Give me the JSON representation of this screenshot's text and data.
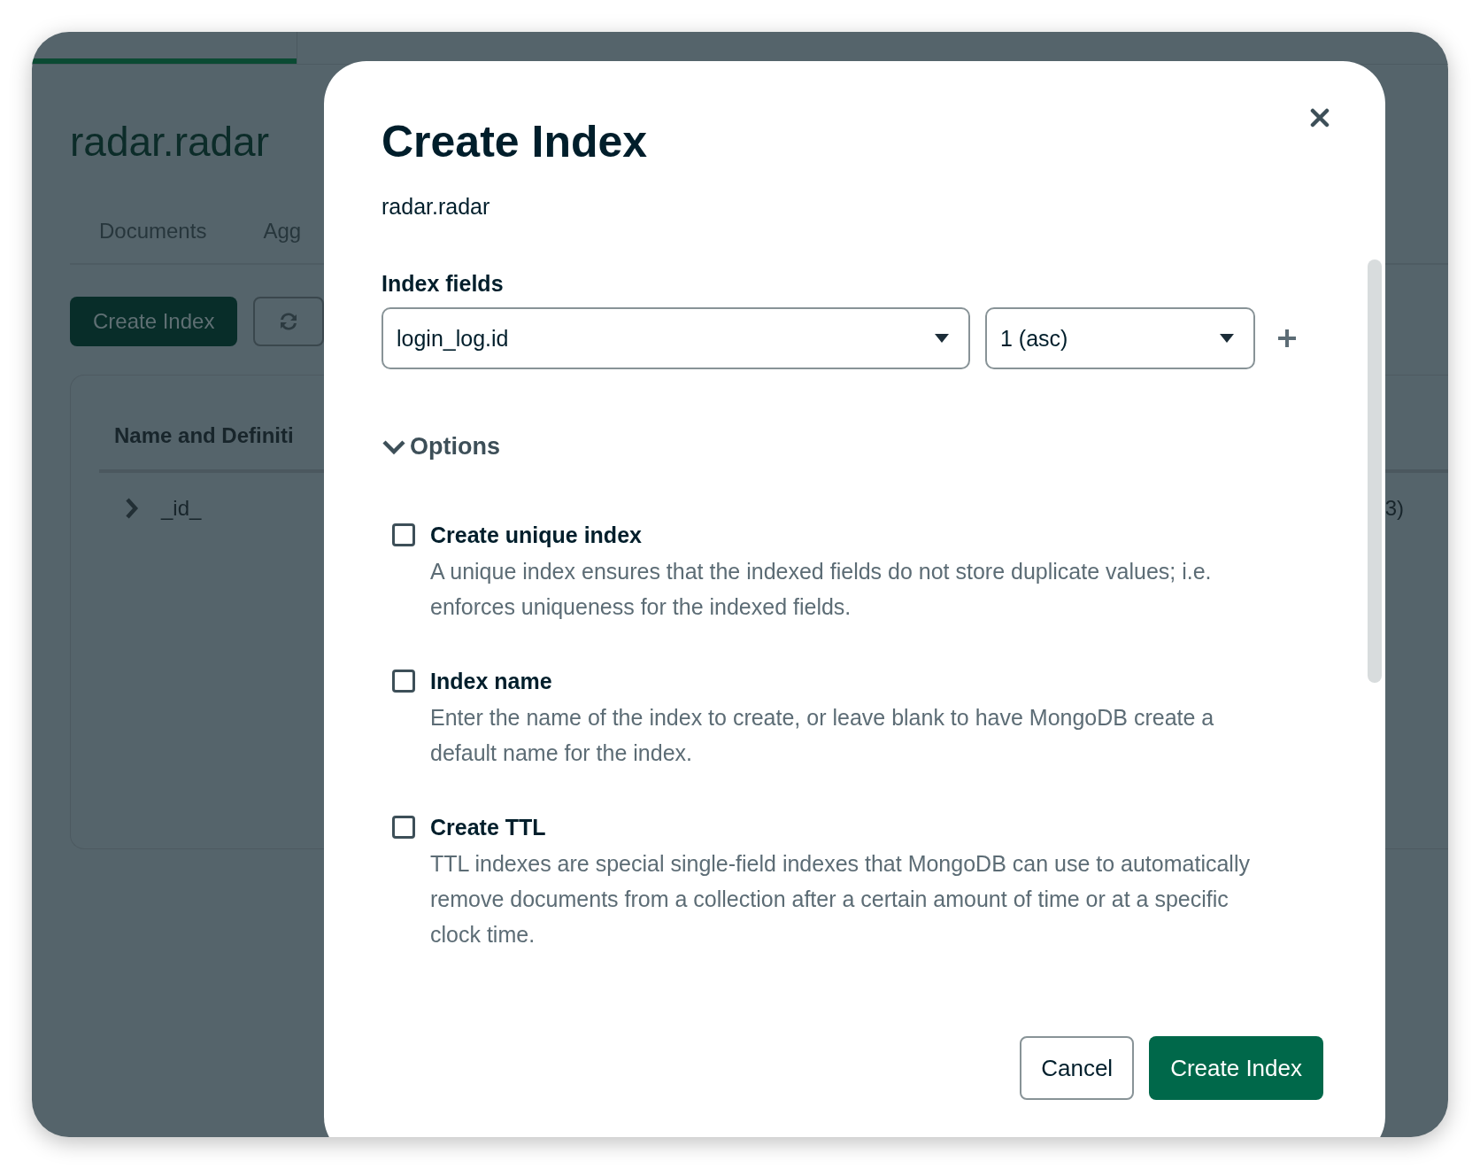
{
  "background": {
    "title": "radar.radar",
    "tabs": [
      {
        "label": "Documents"
      },
      {
        "label": "Agg"
      }
    ],
    "create_button": "Create Index",
    "table": {
      "columns": [
        "Name and Definiti"
      ],
      "rows": [
        {
          "name": "_id_",
          "column_2": "3)",
          "expanded": false
        }
      ]
    }
  },
  "dialog": {
    "title": "Create Index",
    "namespace": "radar.radar",
    "index_fields_label": "Index fields",
    "fields": [
      {
        "value": "login_log.id",
        "direction": "1 (asc)"
      }
    ],
    "options": {
      "label": "Options",
      "expanded": true,
      "items": [
        {
          "label": "Create unique index",
          "description": "A unique index ensures that the indexed fields do not store duplicate values; i.e. enforces uniqueness for the indexed fields.",
          "checked": false
        },
        {
          "label": "Index name",
          "description": "Enter the name of the index to create, or leave blank to have MongoDB create a default name for the index.",
          "checked": false
        },
        {
          "label": "Create TTL",
          "description": "TTL indexes are special single-field indexes that MongoDB can use to automatically remove documents from a collection after a certain amount of time or at a specific clock time.",
          "checked": false
        }
      ]
    },
    "buttons": {
      "cancel": "Cancel",
      "submit": "Create Index"
    }
  }
}
